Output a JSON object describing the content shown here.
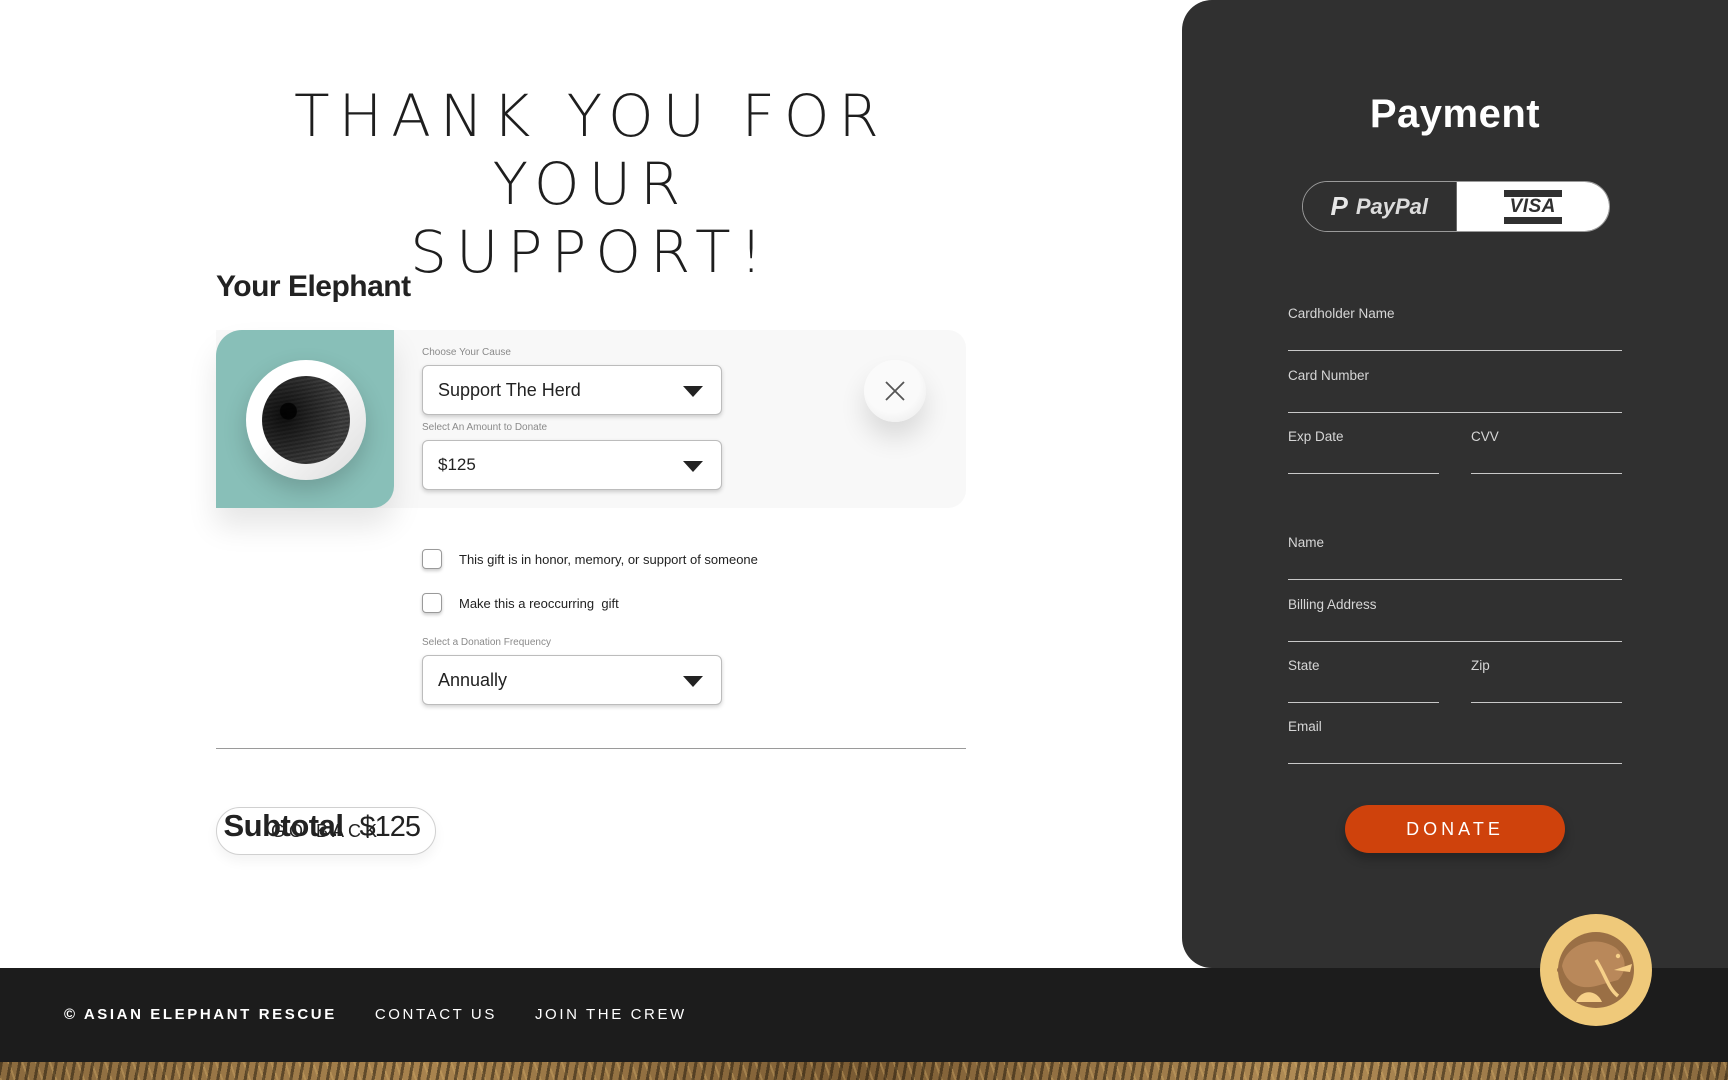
{
  "hero": {
    "line1": "THANK YOU FOR YOUR",
    "line2": "SUPPORT!"
  },
  "elephant": {
    "section_title": "Your Elephant",
    "cause_label": "Choose Your Cause",
    "cause_value": "Support The Herd",
    "amount_label": "Select An Amount to Donate",
    "amount_value": "$125",
    "remove_icon": "close-icon"
  },
  "options": {
    "honor_label": "This gift is in honor, memory, or support of someone",
    "honor_checked": false,
    "recurring_label": "Make this a reoccurring  gift",
    "recurring_checked": false,
    "frequency_label": "Select a Donation Frequency",
    "frequency_value": "Annually"
  },
  "summary": {
    "go_back_label": "GO BACK",
    "subtotal_label": "Subtotal",
    "subtotal_value": "$125"
  },
  "payment": {
    "title": "Payment",
    "methods": [
      {
        "name": "PayPal",
        "icon": "paypal-logo-icon",
        "selected": false
      },
      {
        "name": "VISA",
        "icon": "visa-logo-icon",
        "selected": true
      }
    ],
    "fields": {
      "cardholder_name": {
        "label": "Cardholder Name",
        "value": ""
      },
      "card_number": {
        "label": "Card Number",
        "value": ""
      },
      "exp_date": {
        "label": "Exp Date",
        "value": ""
      },
      "cvv": {
        "label": "CVV",
        "value": ""
      },
      "name": {
        "label": "Name",
        "value": ""
      },
      "billing_address": {
        "label": "Billing Address",
        "value": ""
      },
      "state": {
        "label": "State",
        "value": ""
      },
      "zip": {
        "label": "Zip",
        "value": ""
      },
      "email": {
        "label": "Email",
        "value": ""
      }
    },
    "donate_label": "DONATE",
    "accent_color": "#cf420c"
  },
  "footer": {
    "brand": "© ASIAN ELEPHANT RESCUE",
    "links": [
      "CONTACT US",
      "JOIN THE CREW"
    ],
    "logo_icon": "elephant-logo-icon"
  },
  "colors": {
    "panel_bg": "#303030",
    "footer_bg": "#1c1c1c",
    "card_teal": "#88bfb8",
    "logo_gold": "#efc97a"
  }
}
